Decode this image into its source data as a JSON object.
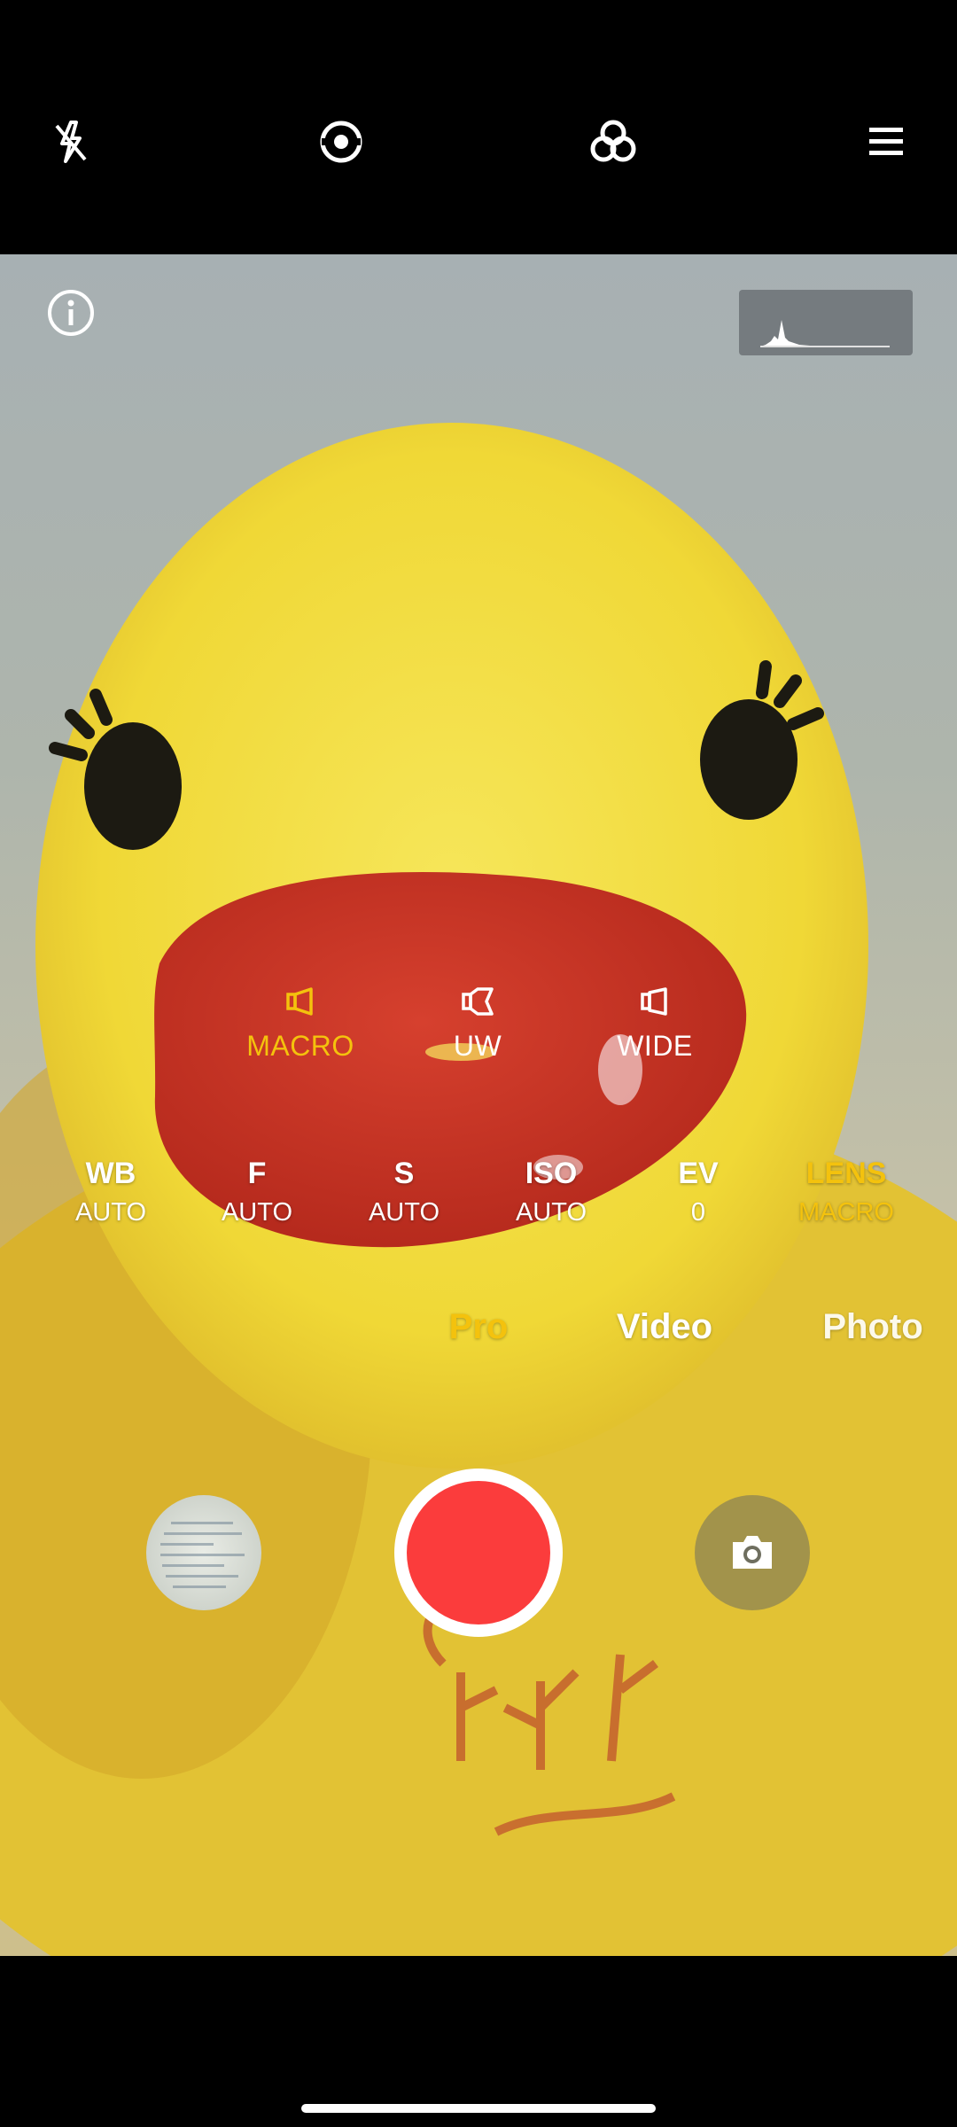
{
  "top_bar": {
    "icons": [
      "flash-off-icon",
      "capture-mode-icon",
      "filter-icon",
      "menu-icon"
    ]
  },
  "viewfinder": {
    "info_icon": "info-icon",
    "histogram_icon": "histogram-icon"
  },
  "lens_options": [
    {
      "label": "MACRO",
      "selected": true
    },
    {
      "label": "UW",
      "selected": false
    },
    {
      "label": "WIDE",
      "selected": false
    }
  ],
  "pro_params": [
    {
      "name": "WB",
      "value": "AUTO",
      "active": false
    },
    {
      "name": "F",
      "value": "AUTO",
      "active": false
    },
    {
      "name": "S",
      "value": "AUTO",
      "active": false
    },
    {
      "name": "ISO",
      "value": "AUTO",
      "active": false
    },
    {
      "name": "EV",
      "value": "0",
      "active": false
    },
    {
      "name": "LENS",
      "value": "MACRO",
      "active": true
    }
  ],
  "modes": [
    {
      "label": "Pro",
      "selected": true
    },
    {
      "label": "Video",
      "selected": false
    },
    {
      "label": "Photo",
      "selected": false
    }
  ],
  "colors": {
    "accent": "#f4c20d",
    "shutter_red": "#fb3c3c"
  }
}
